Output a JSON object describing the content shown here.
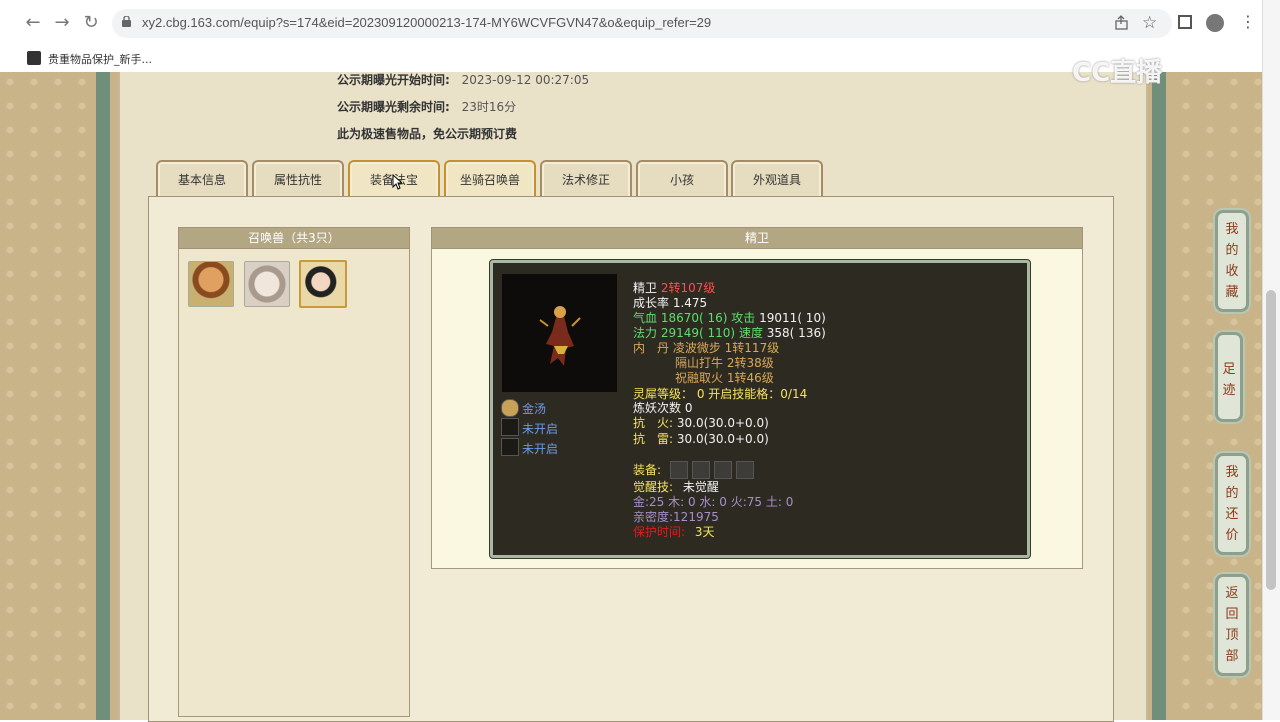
{
  "browser": {
    "url": "xy2.cbg.163.com/equip?s=174&eid=202309120000213-174-MY6WCVFGVN47&o&equip_refer=29",
    "bookmark_label": "贵重物品保护_新手..."
  },
  "watermark": "CC直播",
  "info": {
    "start_label": "公示期曝光开始时间:",
    "start_value": "2023-09-12 00:27:05",
    "remain_label": "公示期曝光剩余时间:",
    "remain_value": "23时16分",
    "note": "此为极速售物品，免公示期预订费"
  },
  "tabs": [
    {
      "label": "基本信息"
    },
    {
      "label": "属性抗性"
    },
    {
      "label": "装备法宝"
    },
    {
      "label": "坐骑召唤兽"
    },
    {
      "label": "法术修正"
    },
    {
      "label": "小孩"
    },
    {
      "label": "外观道具"
    }
  ],
  "pet_list": {
    "title": "召唤兽（共3只）"
  },
  "detail": {
    "title": "精卫",
    "name": "精卫",
    "level": "2转107级",
    "growth": "成长率 1.475",
    "hp_label": "气血",
    "hp_value": "18670( 16)",
    "atk_label": "攻击",
    "atk_value": "19011( 10)",
    "mp_label": "法力",
    "mp_value": "29149( 110)",
    "spd_label": "速度",
    "spd_value": "358( 136)",
    "neidan_label": "内　丹",
    "neidan": [
      "凌波微步 1转117级",
      "隔山打牛 2转38级",
      "祝融取火 1转46级"
    ],
    "lingxi": "灵犀等级： 0 开启技能格：0/14",
    "lianyao": "炼妖次数 0",
    "resist_fire_label": "抗　火:",
    "resist_fire": "30.0(30.0+0.0)",
    "resist_thunder_label": "抗　雷:",
    "resist_thunder": "30.0(30.0+0.0)",
    "equip_label": "装备:",
    "awaken_label": "觉醒技:",
    "awaken_value": "未觉醒",
    "elements": "金:25 木: 0 水: 0 火:75 土: 0",
    "intimacy": "亲密度:121975",
    "protect_label": "保护时间:",
    "protect_value": "3天",
    "left_items": [
      "金汤",
      "未开启",
      "未开启"
    ]
  },
  "side_buttons": [
    "我的收藏",
    "足迹",
    "我的还价",
    "返回顶部"
  ]
}
